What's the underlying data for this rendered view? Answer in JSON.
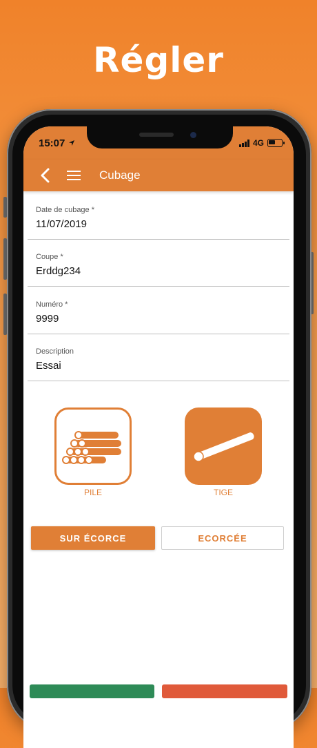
{
  "headline": "Régler",
  "status": {
    "time": "15:07",
    "network": "4G"
  },
  "appbar": {
    "title": "Cubage"
  },
  "fields": [
    {
      "label": "Date de cubage *",
      "value": "11/07/2019"
    },
    {
      "label": "Coupe *",
      "value": "Erddg234"
    },
    {
      "label": "Numéro *",
      "value": "9999"
    },
    {
      "label": "Description",
      "value": "Essai"
    }
  ],
  "types": {
    "pile_label": "PILE",
    "tige_label": "TIGE"
  },
  "bark": {
    "sur_ecorce_label": "SUR ÉCORCE",
    "ecorcee_label": "ECORCÉE"
  },
  "colors": {
    "accent": "#e07f36",
    "background_top": "#f0822a",
    "background_bottom": "#f7b06a",
    "bottom_left": "#2e8b57",
    "bottom_right": "#e05a3a"
  },
  "icons": [
    "back-arrow-icon",
    "hamburger-menu-icon",
    "location-arrow-icon",
    "signal-bars-icon",
    "battery-icon",
    "log-pile-icon",
    "log-pole-icon"
  ]
}
